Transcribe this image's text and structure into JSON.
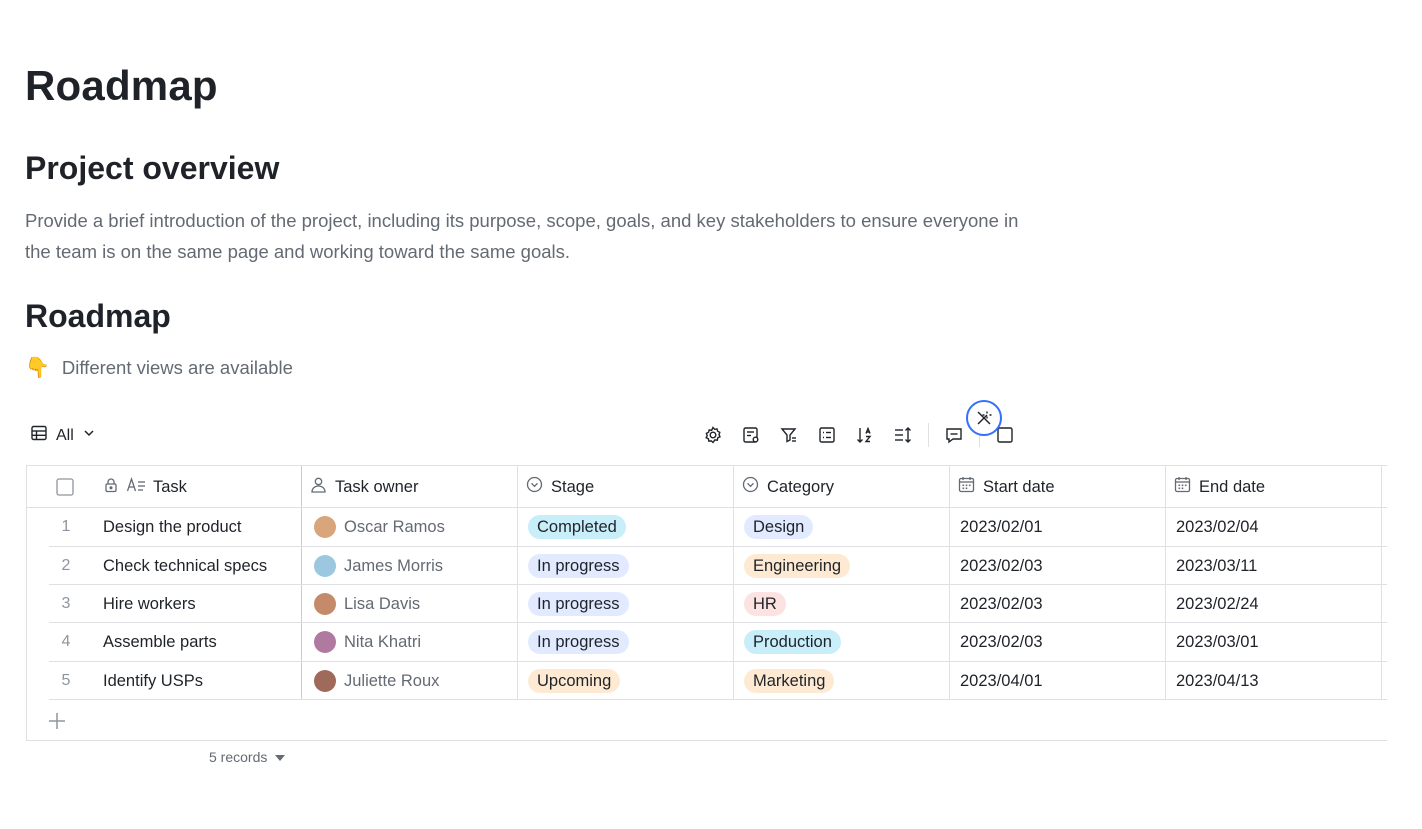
{
  "page": {
    "title": "Roadmap",
    "overview_heading": "Project overview",
    "overview_text": "Provide a brief introduction of the project, including its purpose, scope, goals, and key stakeholders to ensure everyone in the team is on the same page and working toward the same goals.",
    "roadmap_heading": "Roadmap",
    "hint_emoji": "👇",
    "hint_text": "Different views are available"
  },
  "view": {
    "label": "All",
    "icon": "table-grid-icon"
  },
  "toolbar": {
    "icons": [
      "settings-icon",
      "field-settings-icon",
      "filter-icon",
      "group-icon",
      "sort-icon",
      "row-height-icon",
      "comment-icon",
      "expand-icon"
    ],
    "ai_icon": "magic-wand-icon"
  },
  "table": {
    "columns": [
      {
        "key": "task",
        "label": "Task",
        "icon": "text-field-icon"
      },
      {
        "key": "owner",
        "label": "Task owner",
        "icon": "person-icon"
      },
      {
        "key": "stage",
        "label": "Stage",
        "icon": "single-select-icon"
      },
      {
        "key": "category",
        "label": "Category",
        "icon": "single-select-icon"
      },
      {
        "key": "start",
        "label": "Start date",
        "icon": "calendar-icon"
      },
      {
        "key": "end",
        "label": "End date",
        "icon": "calendar-icon"
      }
    ],
    "rows": [
      {
        "num": "1",
        "task": "Design the product",
        "owner": "Oscar Ramos",
        "stage": "Completed",
        "category": "Design",
        "start": "2023/02/01",
        "end": "2023/02/04"
      },
      {
        "num": "2",
        "task": "Check technical specs",
        "owner": "James Morris",
        "stage": "In progress",
        "category": "Engineering",
        "start": "2023/02/03",
        "end": "2023/03/11"
      },
      {
        "num": "3",
        "task": "Hire workers",
        "owner": "Lisa Davis",
        "stage": "In progress",
        "category": "HR",
        "start": "2023/02/03",
        "end": "2023/02/24"
      },
      {
        "num": "4",
        "task": "Assemble parts",
        "owner": "Nita Khatri",
        "stage": "In progress",
        "category": "Production",
        "start": "2023/02/03",
        "end": "2023/03/01"
      },
      {
        "num": "5",
        "task": "Identify USPs",
        "owner": "Juliette Roux",
        "stage": "Upcoming",
        "category": "Marketing",
        "start": "2023/04/01",
        "end": "2023/04/13"
      }
    ],
    "add_icon": "plus-icon",
    "footer": "5 records"
  },
  "colors": {
    "stage": {
      "Completed": "#c8eefa",
      "In progress": "#e1eaff",
      "Upcoming": "#feead2"
    },
    "category": {
      "Design": "#e1eaff",
      "Engineering": "#feead2",
      "HR": "#fde2e2",
      "Production": "#c8eefa",
      "Marketing": "#feead2"
    },
    "avatars": [
      "#d9a57a",
      "#9cc7e0",
      "#c48a6a",
      "#b07aa0",
      "#a06a5a"
    ]
  }
}
